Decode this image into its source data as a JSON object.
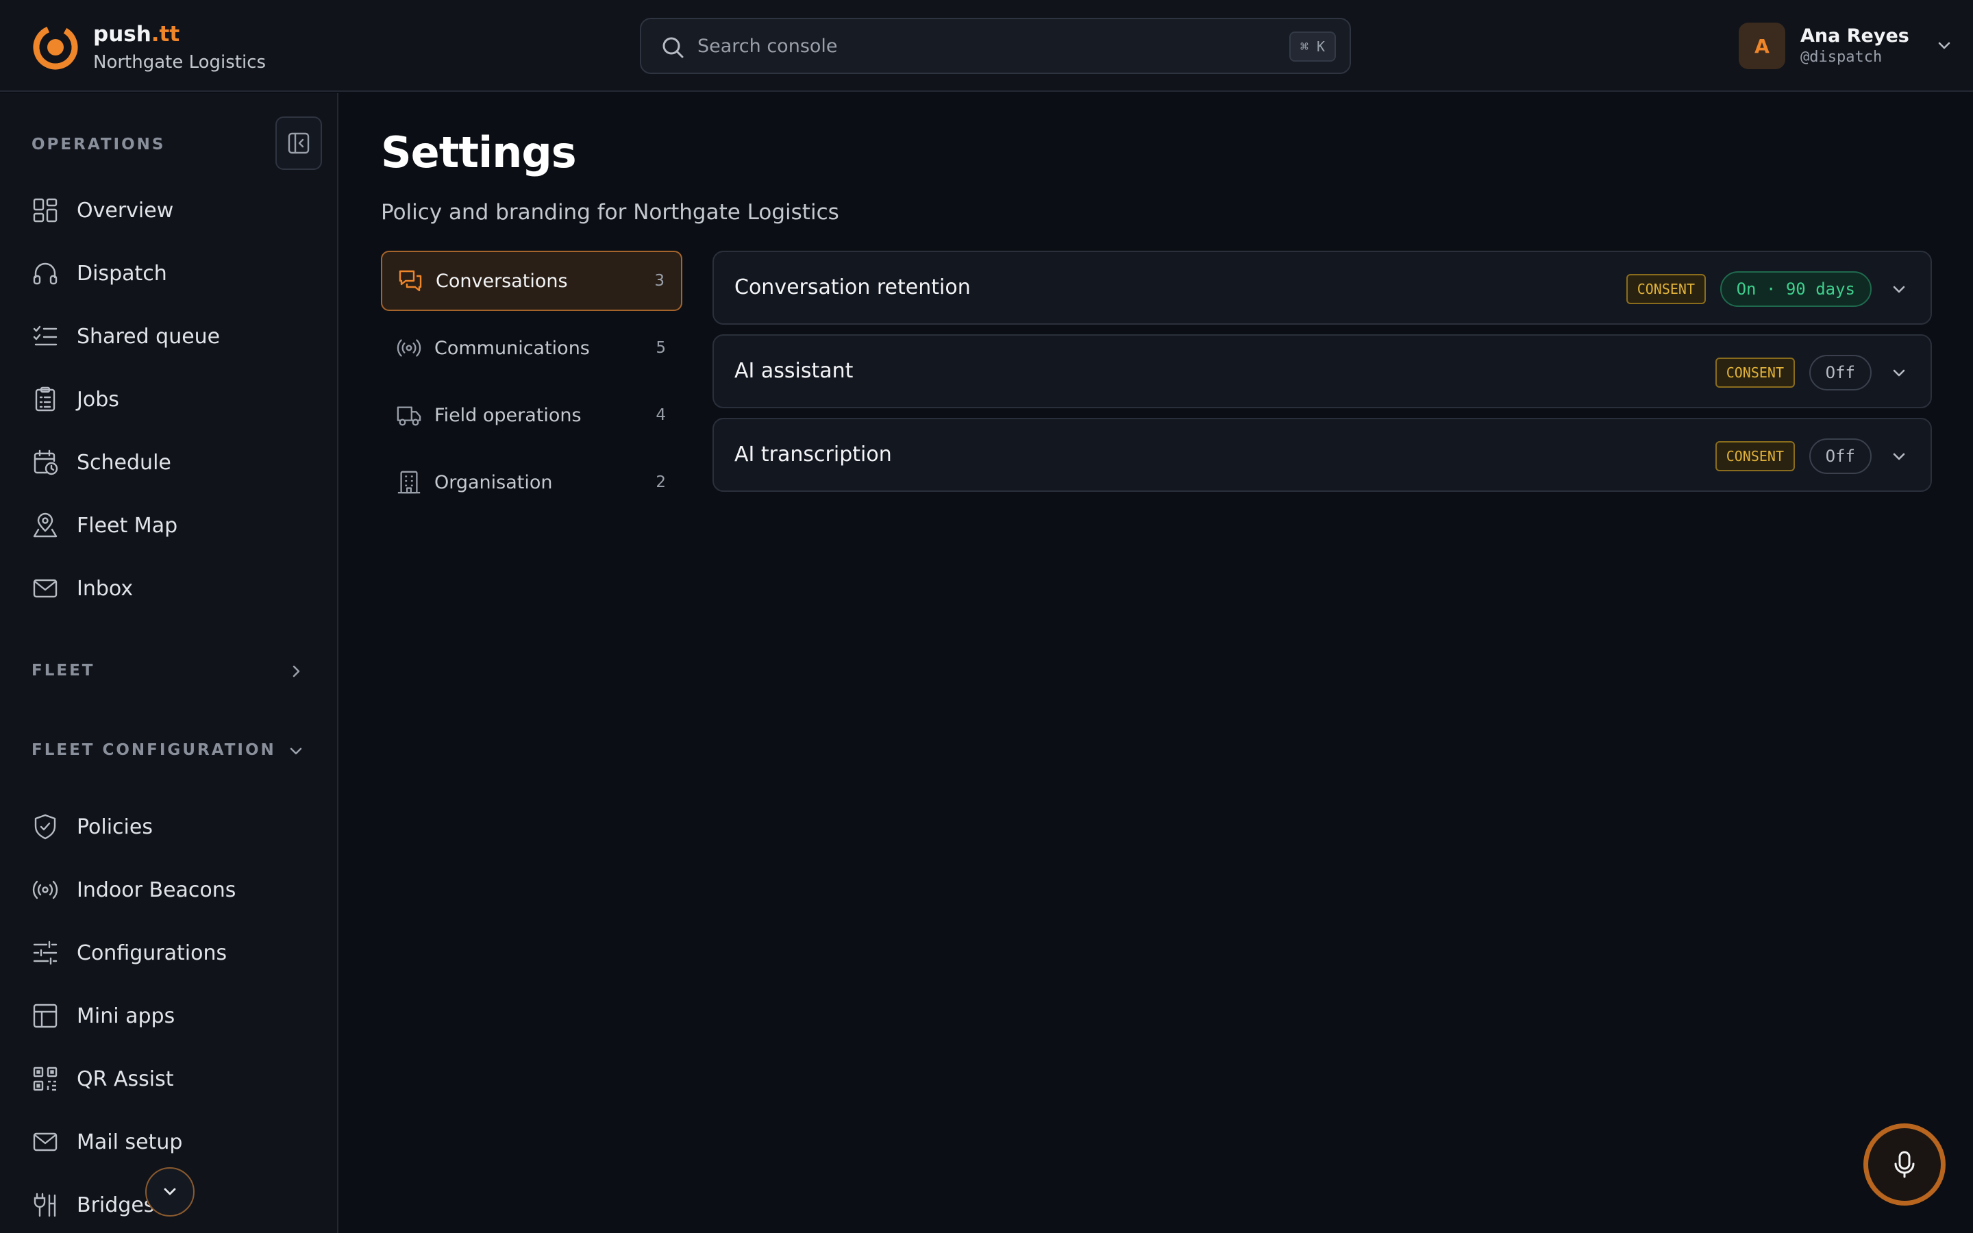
{
  "brand": {
    "name": "push",
    "tld": ".tt",
    "org": "Northgate Logistics",
    "accent": "#f0862a"
  },
  "search": {
    "placeholder": "Search console",
    "shortcut": "⌘ K"
  },
  "user": {
    "initial": "A",
    "name": "Ana Reyes",
    "handle": "@dispatch"
  },
  "sidebar": {
    "operations_title": "OPERATIONS",
    "operations": [
      {
        "label": "Overview",
        "icon": "grid-icon"
      },
      {
        "label": "Dispatch",
        "icon": "headset-icon"
      },
      {
        "label": "Shared queue",
        "icon": "list-check-icon"
      },
      {
        "label": "Jobs",
        "icon": "clipboard-icon"
      },
      {
        "label": "Schedule",
        "icon": "calendar-clock-icon"
      },
      {
        "label": "Fleet Map",
        "icon": "map-pin-icon"
      },
      {
        "label": "Inbox",
        "icon": "mail-icon"
      }
    ],
    "fleet_title": "FLEET",
    "fleet_config_title": "FLEET CONFIGURATION",
    "fleet_config": [
      {
        "label": "Policies",
        "icon": "shield-check-icon"
      },
      {
        "label": "Indoor Beacons",
        "icon": "radio-icon"
      },
      {
        "label": "Configurations",
        "icon": "sliders-icon"
      },
      {
        "label": "Mini apps",
        "icon": "layout-icon"
      },
      {
        "label": "QR Assist",
        "icon": "qr-code-icon"
      },
      {
        "label": "Mail setup",
        "icon": "mail-icon"
      },
      {
        "label": "Bridges",
        "icon": "plug-icon"
      }
    ]
  },
  "main": {
    "title": "Settings",
    "subtitle": "Policy and branding for Northgate Logistics",
    "categories": [
      {
        "label": "Conversations",
        "count": "3",
        "icon": "chat-icon",
        "active": true
      },
      {
        "label": "Communications",
        "count": "5",
        "icon": "radio-icon",
        "active": false
      },
      {
        "label": "Field operations",
        "count": "4",
        "icon": "truck-icon",
        "active": false
      },
      {
        "label": "Organisation",
        "count": "2",
        "icon": "building-icon",
        "active": false
      }
    ],
    "settings": [
      {
        "title": "Conversation retention",
        "badge": "CONSENT",
        "status": "On · 90 days",
        "state": "on"
      },
      {
        "title": "AI assistant",
        "badge": "CONSENT",
        "status": "Off",
        "state": "off"
      },
      {
        "title": "AI transcription",
        "badge": "CONSENT",
        "status": "Off",
        "state": "off"
      }
    ]
  },
  "colors": {
    "background": "#0b0e14",
    "panel": "#10131a",
    "accent": "#f0862a",
    "consent": "#e0b23a",
    "on": "#3fcf8e"
  }
}
